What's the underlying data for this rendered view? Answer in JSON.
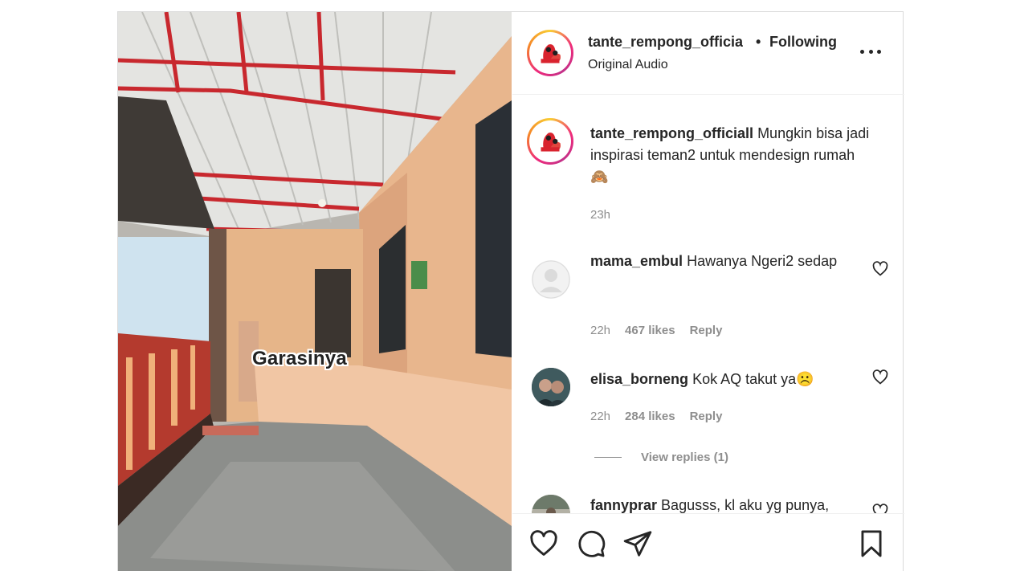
{
  "media": {
    "caption": "Garasinya"
  },
  "header": {
    "username": "tante_rempong_officia",
    "separator": "•",
    "follow_status": "Following",
    "audio": "Original Audio"
  },
  "caption": {
    "username": "tante_rempong_officiall",
    "text": "Mungkin bisa jadi inspirasi teman2 untuk mendesign rumah 🙈",
    "time": "23h"
  },
  "comments": [
    {
      "username": "mama_embul",
      "text": "Hawanya Ngeri2 sedap",
      "time": "22h",
      "likes": "467 likes",
      "reply": "Reply"
    },
    {
      "username": "elisa_borneng",
      "text": "Kok AQ takut ya☹️",
      "time": "22h",
      "likes": "284 likes",
      "reply": "Reply",
      "view_replies": "View replies (1)"
    },
    {
      "username": "fannyprar",
      "text": "Bagusss, kl aku yg punya,",
      "time": "",
      "likes": "",
      "reply": ""
    }
  ],
  "icons": {
    "like": "heart-icon",
    "comment": "comment-icon",
    "share": "share-icon",
    "save": "bookmark-icon",
    "more": "more-icon"
  }
}
